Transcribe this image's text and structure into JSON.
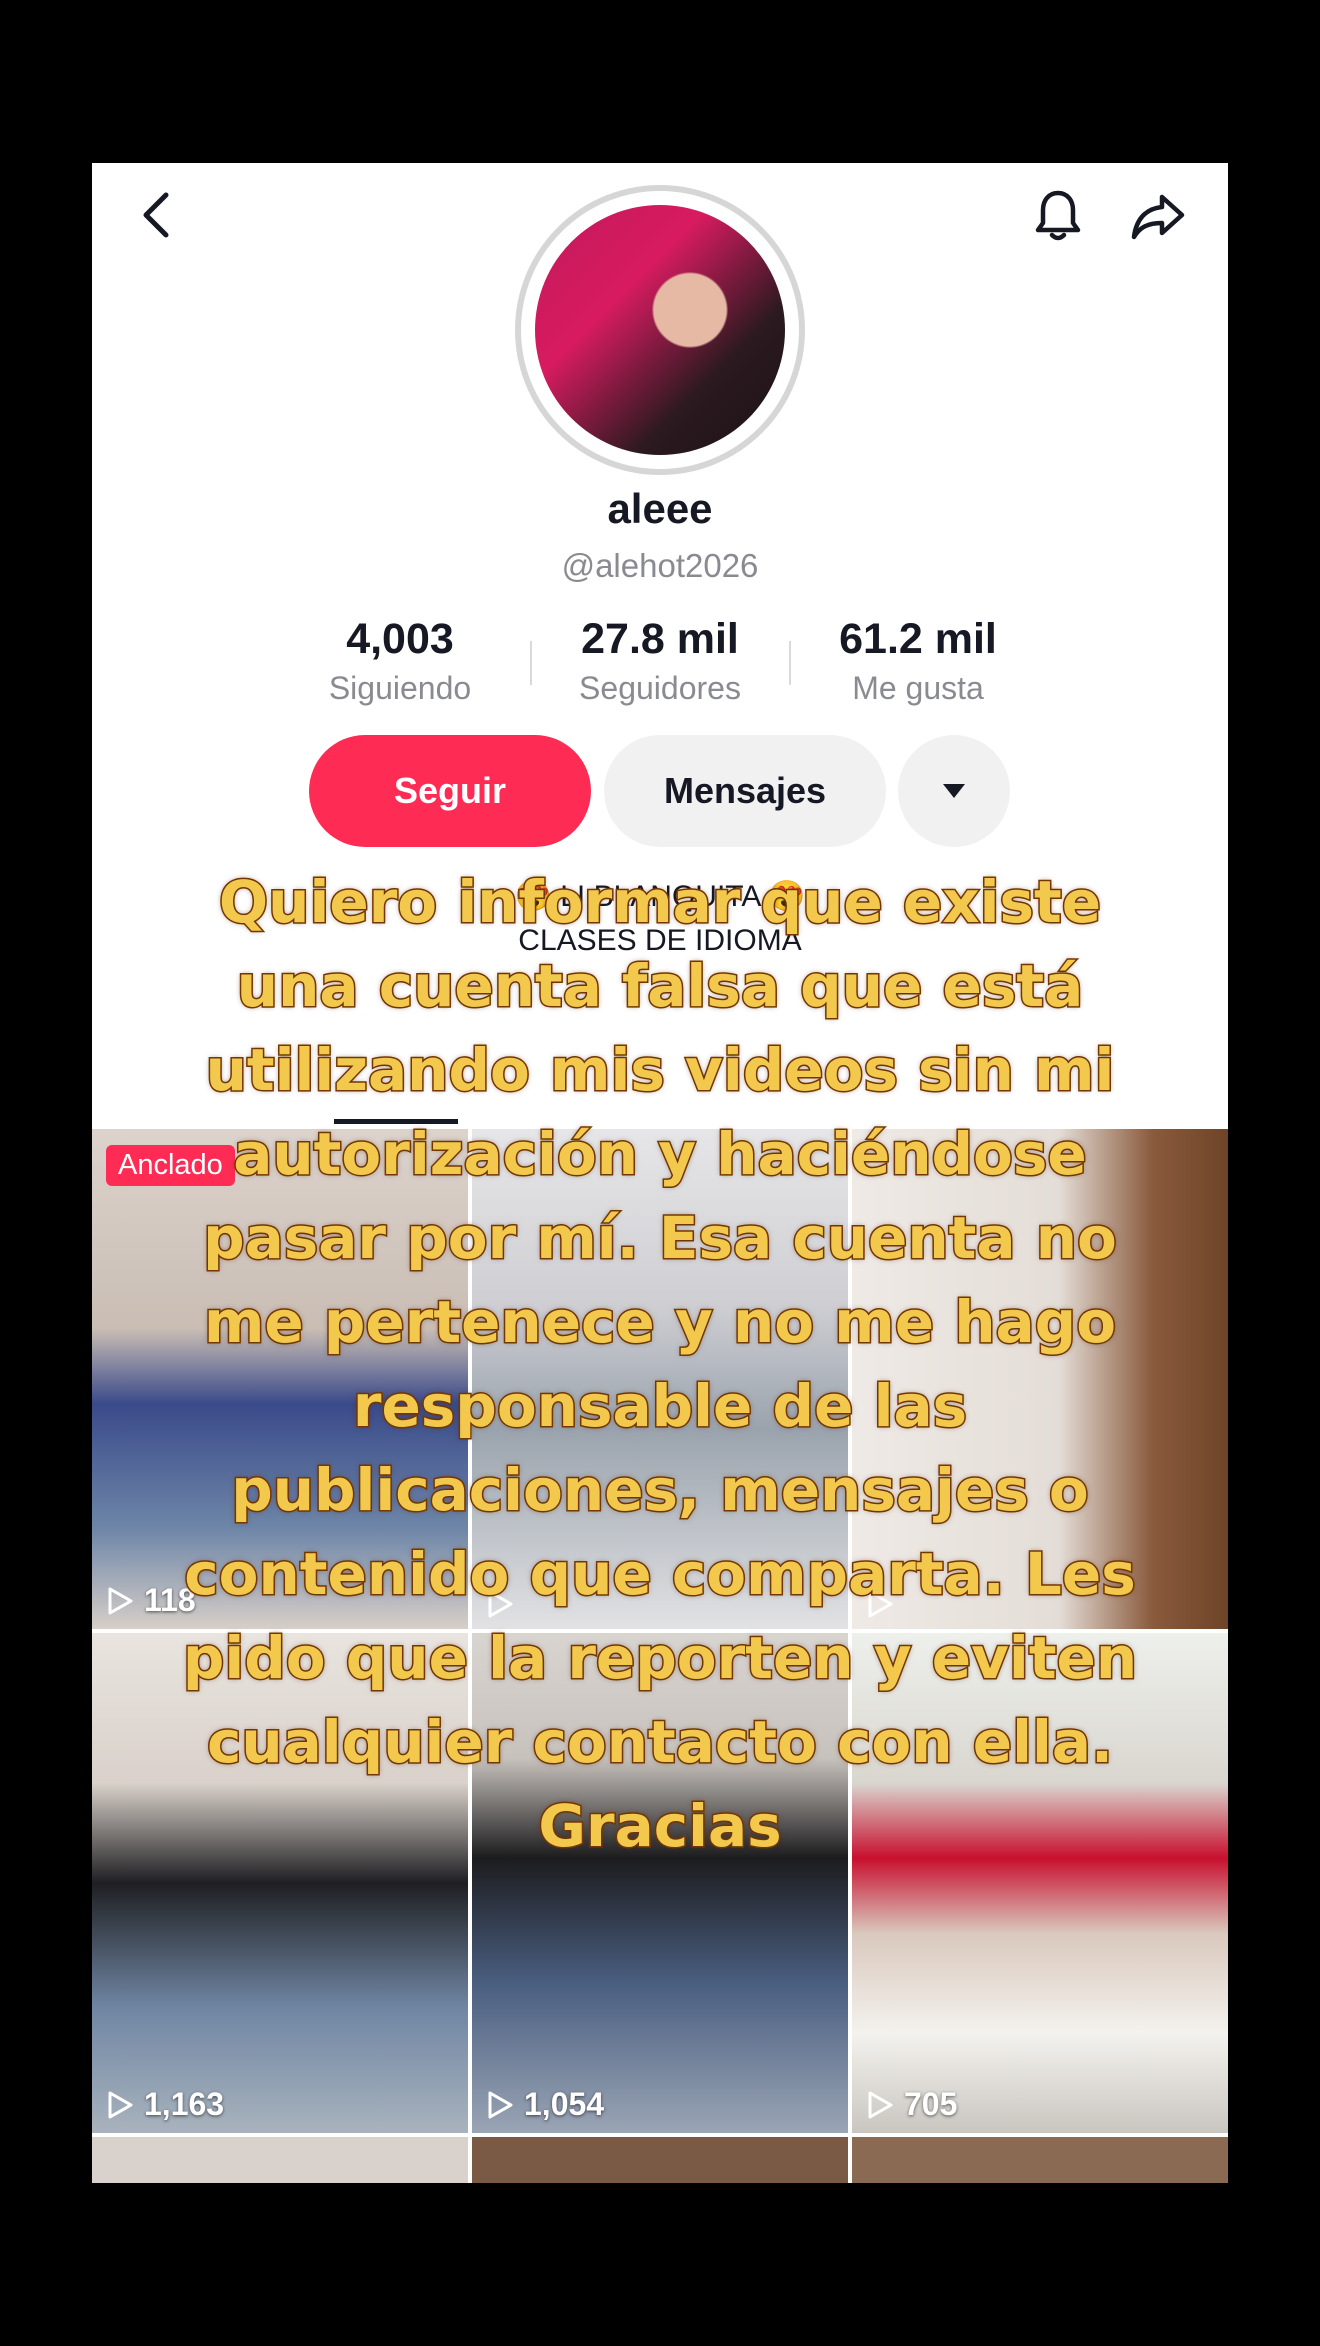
{
  "profile": {
    "name": "aleee",
    "handle": "@alehot2026"
  },
  "stats": [
    {
      "value": "4,003",
      "label": "Siguiendo"
    },
    {
      "value": "27.8 mil",
      "label": "Seguidores"
    },
    {
      "value": "61.2 mil",
      "label": "Me gusta"
    }
  ],
  "actions": {
    "follow_label": "Seguir",
    "message_label": "Mensajes"
  },
  "bio": {
    "line1": "😍 LI BLANQUITA 😍",
    "line2": "CLASES DE IDIOMA"
  },
  "videos": [
    {
      "views": "118",
      "badge": "Anclado"
    },
    {
      "views": ""
    },
    {
      "views": ""
    },
    {
      "views": "1,163"
    },
    {
      "views": "1,054"
    },
    {
      "views": "705"
    }
  ],
  "overlay_caption": "Quiero informar que existe una cuenta falsa que está utilizando mis videos sin mi autorización y haciéndose pasar por mí. Esa cuenta no me pertenece y no me hago responsable de las publicaciones, mensajes o contenido que comparta. Les pido que la reporten y eviten cualquier contacto con ella. Gracias",
  "colors": {
    "follow_button": "#fe2c55",
    "caption_fill": "#f2c94c",
    "caption_stroke": "#7a3b00"
  },
  "icons": [
    "back-arrow-icon",
    "bell-icon",
    "share-icon",
    "dropdown-caret-icon",
    "play-icon"
  ]
}
